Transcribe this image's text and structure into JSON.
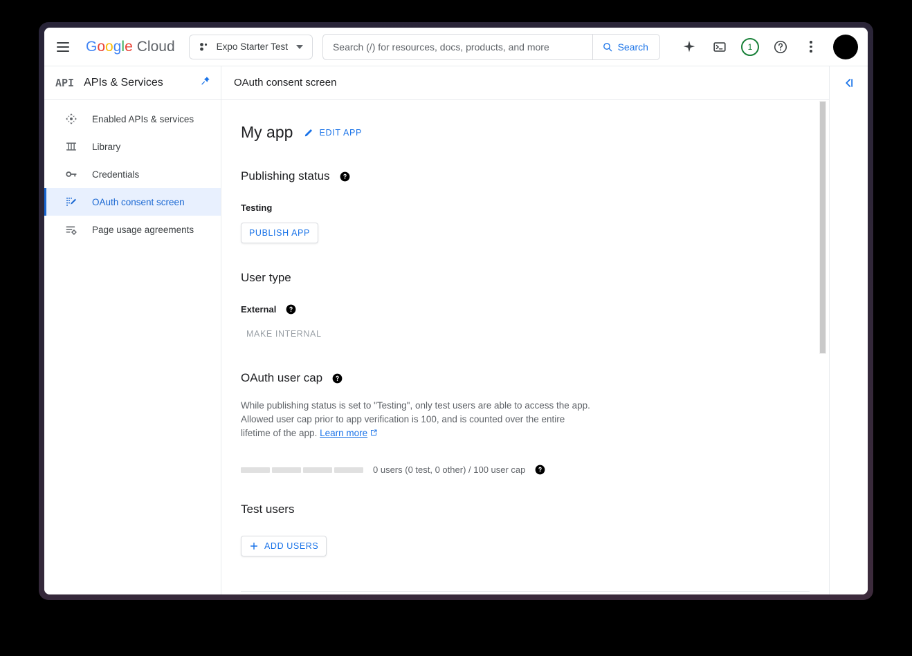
{
  "topbar": {
    "menu_icon": "hamburger-menu-icon",
    "brand": {
      "g1": "G",
      "g2": "o",
      "g3": "o",
      "g4": "g",
      "g5": "l",
      "g6": "e",
      "cloud": "Cloud"
    },
    "project_selector": {
      "label": "Expo Starter Test",
      "icon": "project-dots-icon"
    },
    "search": {
      "placeholder": "Search (/) for resources, docs, products, and more",
      "value": "",
      "button_label": "Search",
      "icon": "search-icon"
    },
    "actions": [
      {
        "name": "gemini-sparkle-icon",
        "label": ""
      },
      {
        "name": "cloud-shell-terminal-icon",
        "label": ""
      },
      {
        "name": "notifications-badge",
        "label": "1",
        "color": "#188038"
      },
      {
        "name": "help-icon",
        "label": ""
      },
      {
        "name": "more-options-kebab-icon",
        "label": ""
      }
    ],
    "avatar": {
      "name": "user-avatar",
      "color": "#000000"
    }
  },
  "sidebar": {
    "logo_text": "API",
    "title": "APIs & Services",
    "pin_icon": "pin-icon",
    "pin_color": "#1a73e8",
    "items": [
      {
        "label": "Enabled APIs & services",
        "icon": "dashboard-arrows-icon",
        "active": false
      },
      {
        "label": "Library",
        "icon": "library-columns-icon",
        "active": false
      },
      {
        "label": "Credentials",
        "icon": "key-icon",
        "active": false
      },
      {
        "label": "OAuth consent screen",
        "icon": "oauth-consent-pencil-icon",
        "active": true
      },
      {
        "label": "Page usage agreements",
        "icon": "list-gear-icon",
        "active": false
      }
    ],
    "active_color": "#1967d2",
    "active_bg": "#e8f0fe"
  },
  "page": {
    "header_title": "OAuth consent screen",
    "app_name": "My app",
    "edit_app": {
      "label": "EDIT APP",
      "icon": "pencil-icon"
    },
    "publishing_status": {
      "heading": "Publishing status",
      "help_icon": "help-filled-icon",
      "status": "Testing",
      "publish_button": "PUBLISH APP"
    },
    "user_type": {
      "heading": "User type",
      "value": "External",
      "help_icon": "help-filled-icon",
      "make_internal_button": "MAKE INTERNAL",
      "make_internal_disabled": true
    },
    "oauth_user_cap": {
      "heading": "OAuth user cap",
      "help_icon": "help-filled-icon",
      "description_part1": "While publishing status is set to \"Testing\", only test users are able to access the app. Allowed user cap prior to app verification is 100, and is counted over the entire lifetime of the app. ",
      "learn_more": "Learn more",
      "learn_more_icon": "external-link-icon",
      "cap_text": "0 users (0 test, 0 other) / 100 user cap",
      "cap_help_icon": "help-filled-icon",
      "bar_segments": 4,
      "bar_filled": 0
    },
    "test_users": {
      "heading": "Test users",
      "add_button": "ADD USERS",
      "add_icon": "plus-icon"
    }
  },
  "right_rail": {
    "collapse_icon": "collapse-panel-icon",
    "collapse_color": "#1a73e8"
  },
  "scrollbar": {
    "name": "vertical-scrollbar",
    "thumb_color": "#c9c9c9"
  }
}
